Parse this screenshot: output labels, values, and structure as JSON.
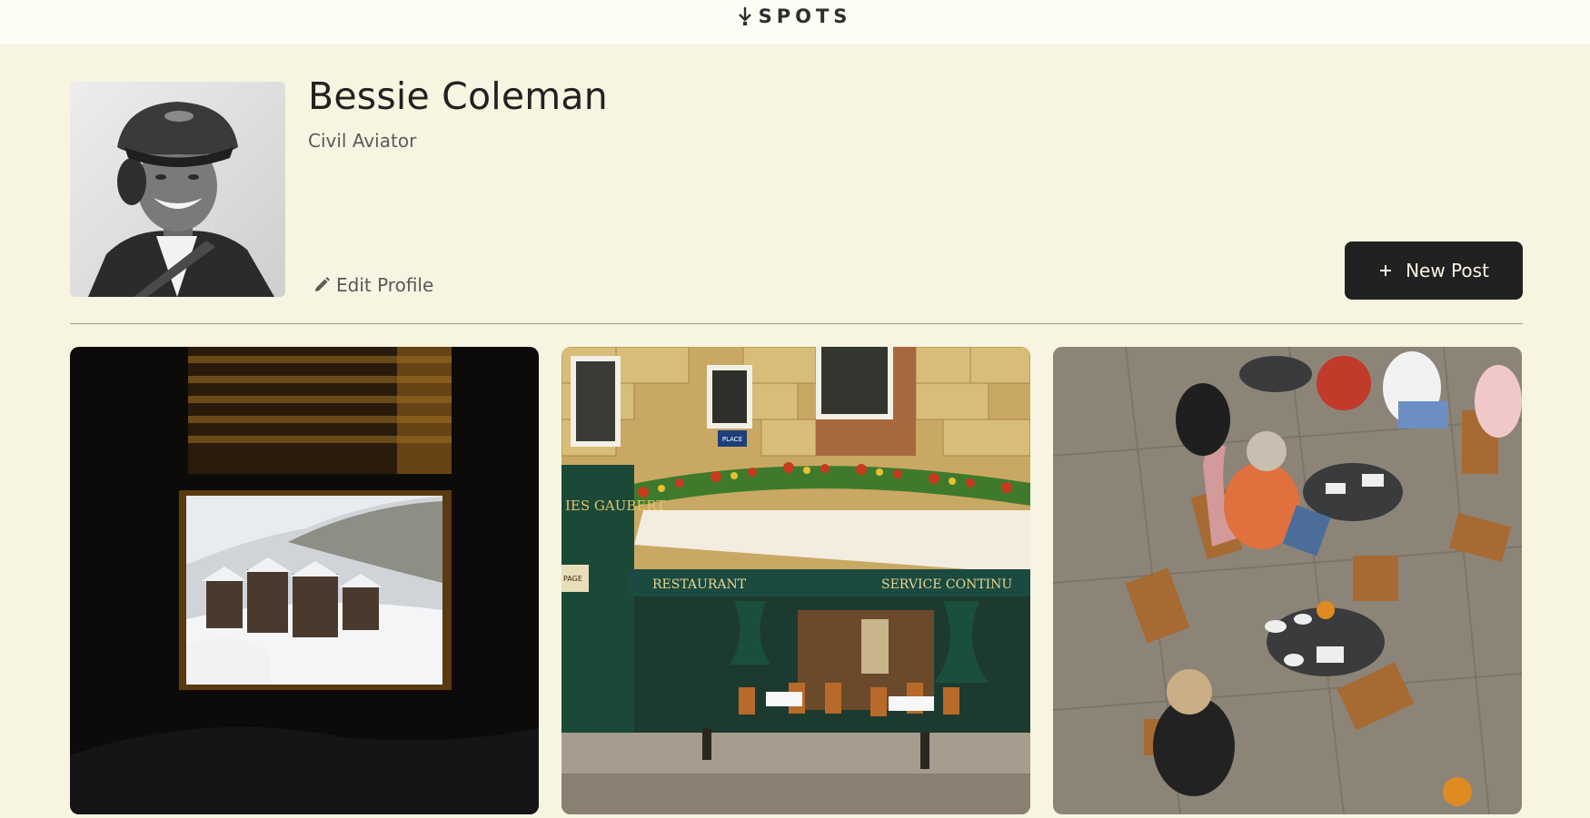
{
  "header": {
    "logo_text": "SPOTS"
  },
  "profile": {
    "name": "Bessie Coleman",
    "description": "Civil Aviator",
    "edit_label": "Edit Profile",
    "new_post_label": "New Post"
  },
  "cards": [
    {
      "scene": "window-mountain-view"
    },
    {
      "scene": "paris-restaurant",
      "sign_left": "IES GAUBERT",
      "awning_left": "RESTAURANT",
      "awning_right": "SERVICE CONTINU",
      "street_plate": "PLACE",
      "menu_board": "PAGE"
    },
    {
      "scene": "cafe-terrace"
    }
  ],
  "colors": {
    "background": "#f7f5e1",
    "button": "#212121",
    "button_text": "#fcf5e5"
  }
}
